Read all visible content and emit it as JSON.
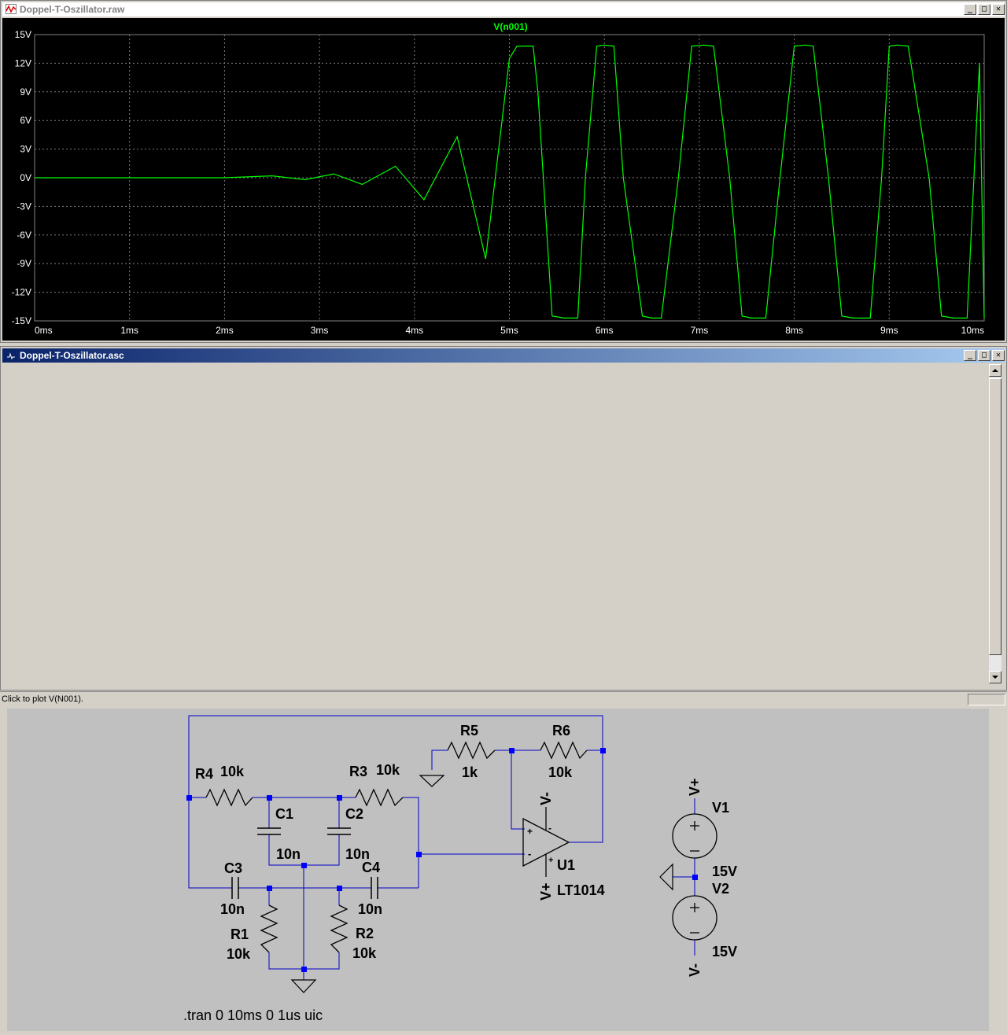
{
  "plot_window": {
    "title": "Doppel-T-Oszillator.raw",
    "buttons": {
      "minimize": "_",
      "restore": "□",
      "close": "✕"
    },
    "trace_label": "V(n001)",
    "colors": {
      "background": "#000000",
      "trace": "#00ff00",
      "grid": "#808080",
      "axis_text": "#ffffff"
    }
  },
  "chart_data": {
    "type": "line",
    "title": "V(n001)",
    "xlabel": "",
    "ylabel": "",
    "xlim": [
      0,
      10
    ],
    "ylim": [
      -15,
      15
    ],
    "x_unit": "ms",
    "y_unit": "V",
    "x_ticks": [
      "0ms",
      "1ms",
      "2ms",
      "3ms",
      "4ms",
      "5ms",
      "6ms",
      "7ms",
      "8ms",
      "9ms",
      "10ms"
    ],
    "y_ticks": [
      "15V",
      "12V",
      "9V",
      "6V",
      "3V",
      "0V",
      "-3V",
      "-6V",
      "-9V",
      "-12V",
      "-15V"
    ],
    "grid": true,
    "series": [
      {
        "name": "V(n001)",
        "x": [
          0,
          1,
          2,
          2.5,
          2.85,
          3.15,
          3.45,
          3.8,
          4.1,
          4.45,
          4.75,
          5.0,
          5.08,
          5.25,
          5.3,
          5.45,
          5.58,
          5.72,
          5.8,
          5.92,
          6.0,
          6.1,
          6.2,
          6.4,
          6.5,
          6.6,
          6.78,
          6.92,
          7.05,
          7.15,
          7.32,
          7.45,
          7.55,
          7.7,
          7.85,
          8.0,
          8.12,
          8.2,
          8.36,
          8.5,
          8.62,
          8.8,
          8.92,
          9.0,
          9.08,
          9.2,
          9.42,
          9.55,
          9.68,
          9.82,
          9.95,
          10.0
        ],
        "y": [
          0,
          0,
          0,
          0.2,
          -0.2,
          0.4,
          -0.7,
          1.2,
          -2.3,
          4.3,
          -8.5,
          12.5,
          13.8,
          13.8,
          9,
          -14.5,
          -14.7,
          -14.7,
          0,
          13.8,
          13.9,
          13.8,
          0,
          -14.5,
          -14.7,
          -14.7,
          0,
          13.8,
          13.9,
          13.8,
          0,
          -14.5,
          -14.7,
          -14.7,
          0,
          13.8,
          13.9,
          13.8,
          0,
          -14.5,
          -14.7,
          -14.7,
          0,
          13.8,
          13.9,
          13.8,
          0,
          -14.5,
          -14.7,
          -14.7,
          12,
          -14.7
        ]
      }
    ]
  },
  "schematic_window": {
    "title": "Doppel-T-Oszillator.asc",
    "buttons": {
      "minimize": "_",
      "restore": "□",
      "close": "✕"
    },
    "colors": {
      "background": "#c0c0c0",
      "wire": "#0000c8",
      "component": "#000000",
      "junction": "#0000ff"
    },
    "labels": {
      "r1_name": "R1",
      "r1_value": "10k",
      "r2_name": "R2",
      "r2_value": "10k",
      "r3_name": "R3",
      "r3_value": "10k",
      "r4_name": "R4",
      "r4_value": "10k",
      "r5_name": "R5",
      "r5_value": "1k",
      "r6_name": "R6",
      "r6_value": "10k",
      "c1_name": "C1",
      "c1_value": "10n",
      "c2_name": "C2",
      "c2_value": "10n",
      "c3_name": "C3",
      "c3_value": "10n",
      "c4_name": "C4",
      "c4_value": "10n",
      "u1_name": "U1",
      "u1_model": "LT1014",
      "u1_vminus": "V-",
      "u1_vplus": "V+",
      "v1_name": "V1",
      "v1_value": "15V",
      "v2_name": "V2",
      "v2_value": "15V",
      "vplus_net": "V+",
      "vminus_net": "V-",
      "opamp_plus": "+",
      "opamp_minus": "-",
      "directive": ".tran 0 10ms 0 1us uic"
    }
  },
  "status_bar": {
    "message": "Click to plot V(N001)."
  }
}
